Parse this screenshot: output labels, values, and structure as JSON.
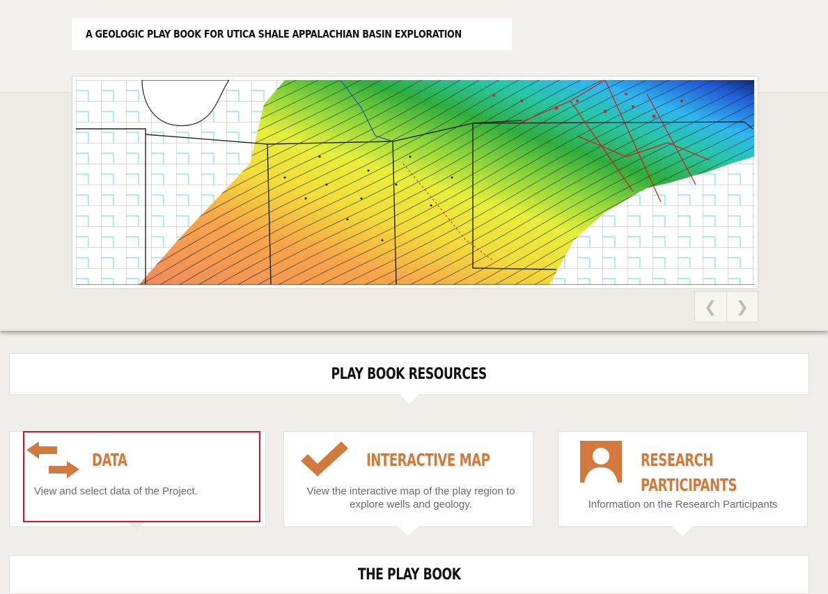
{
  "header": {
    "title": "A GEOLOGIC PLAY BOOK FOR UTICA SHALE APPALACHIAN BASIN EXPLORATION"
  },
  "slider": {
    "prev_icon": "chevron-left-icon",
    "next_icon": "chevron-right-icon",
    "prev_glyph": "❮",
    "next_glyph": "❯"
  },
  "resources": {
    "heading": "PLAY BOOK RESOURCES",
    "cards": [
      {
        "title": "DATA",
        "description": "View and select data of the Project.",
        "icon": "exchange-arrows-icon"
      },
      {
        "title": "INTERACTIVE MAP",
        "description": "View the interactive map of the play region to explore wells and geology.",
        "icon": "checkmark-icon"
      },
      {
        "title": "RESEARCH PARTICIPANTS",
        "title_line1": "RESEARCH",
        "title_line2": "PARTICIPANTS",
        "description": "Information on the Research Participants",
        "icon": "person-icon"
      }
    ]
  },
  "playbook": {
    "heading": "THE PLAY BOOK"
  },
  "colors": {
    "accent_orange": "#d17a3c",
    "highlight_red": "#d4141f",
    "background": "#efeeea"
  }
}
